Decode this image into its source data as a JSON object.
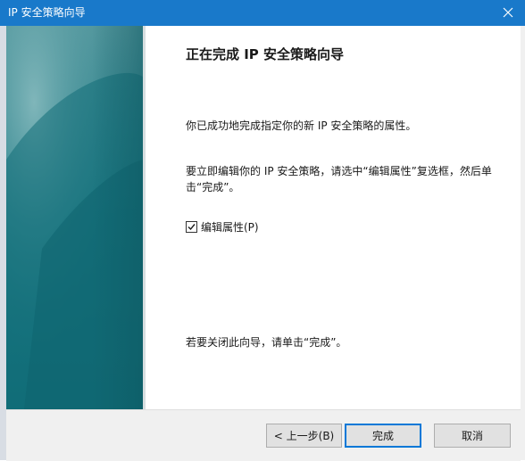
{
  "window": {
    "title": "IP 安全策略向导",
    "close_icon": "close-icon"
  },
  "page": {
    "heading": "正在完成 IP 安全策略向导",
    "completed_text": "你已成功地完成指定你的新 IP 安全策略的属性。",
    "edit_text": "要立即编辑你的 IP 安全策略，请选中“编辑属性”复选框，然后单击“完成”。",
    "edit_checkbox": {
      "label": "编辑属性(P)",
      "checked": true
    },
    "close_text": "若要关闭此向导，请单击“完成”。"
  },
  "buttons": {
    "back": "< 上一步(B)",
    "finish": "完成",
    "cancel": "取消"
  },
  "colors": {
    "titlebar": "#1979ca",
    "accent": "#0078d7",
    "art_teal": "#1f7c86"
  }
}
